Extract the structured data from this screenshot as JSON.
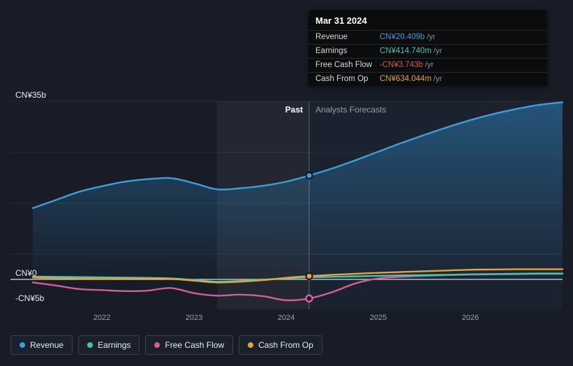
{
  "header": {
    "past_label": "Past",
    "forecast_label": "Analysts Forecasts"
  },
  "tooltip": {
    "date": "Mar 31 2024",
    "rows": [
      {
        "label": "Revenue",
        "value": "CN¥20.409b",
        "suffix": "/yr",
        "color": "#3aa0dc"
      },
      {
        "label": "Earnings",
        "value": "CN¥414.740m",
        "suffix": "/yr",
        "color": "#45c4ae"
      },
      {
        "label": "Free Cash Flow",
        "value": "-CN¥3.743b",
        "suffix": "/yr",
        "color": "#e0524e"
      },
      {
        "label": "Cash From Op",
        "value": "CN¥634.044m",
        "suffix": "/yr",
        "color": "#e5a43b"
      }
    ]
  },
  "legend": {
    "items": [
      {
        "label": "Revenue",
        "color": "#3aa0dc"
      },
      {
        "label": "Earnings",
        "color": "#45c4ae"
      },
      {
        "label": "Free Cash Flow",
        "color": "#d45d9a"
      },
      {
        "label": "Cash From Op",
        "color": "#e5a43b"
      }
    ]
  },
  "colors": {
    "background": "#171c26",
    "zero_line": "#b7bec8",
    "grid": "rgba(255,255,255,0.07)",
    "divider": "rgba(255,255,255,0.3)",
    "forecast_bg": "rgba(110,150,210,0.05)",
    "hover_band": "rgba(255,255,255,0.05)"
  },
  "chart_data": {
    "type": "line",
    "title": "Revenue, earnings and cash flow history with analyst forecasts (CN¥ billions)",
    "ylim": [
      -9.5,
      35
    ],
    "grid": true,
    "legend_position": "bottom-left",
    "y_ticks": [
      {
        "label": "CN¥35b",
        "value": 35
      },
      {
        "label": "CN¥0",
        "value": 0
      },
      {
        "label": "-CN¥5b",
        "value": -5
      }
    ],
    "y_gridlines": [
      35,
      25,
      15,
      5
    ],
    "x_ticks": [
      {
        "label": "2022",
        "value": 2022
      },
      {
        "label": "2023",
        "value": 2023
      },
      {
        "label": "2024",
        "value": 2024
      },
      {
        "label": "2025",
        "value": 2025
      },
      {
        "label": "2026",
        "value": 2026
      }
    ],
    "divider_x": 2024.25,
    "hover_band": [
      2023.25,
      2024.25
    ],
    "marker_x": 2024.25,
    "past_range": [
      2021.25,
      2024.25
    ],
    "forecast_range": [
      2024.25,
      2027
    ],
    "x": [
      2021.25,
      2021.5,
      2021.75,
      2022,
      2022.25,
      2022.5,
      2022.75,
      2023,
      2023.25,
      2023.5,
      2023.75,
      2024,
      2024.25,
      2024.5,
      2024.75,
      2025,
      2025.25,
      2025.5,
      2025.75,
      2026,
      2026.25,
      2026.5,
      2026.75,
      2027
    ],
    "series": [
      {
        "name": "Revenue",
        "color": "#3aa0dc",
        "area": true,
        "marker": "solid",
        "values": [
          14.0,
          15.6,
          17.2,
          18.3,
          19.2,
          19.7,
          19.9,
          18.9,
          17.7,
          17.9,
          18.4,
          19.2,
          20.409,
          21.8,
          23.4,
          25.1,
          26.8,
          28.4,
          29.9,
          31.3,
          32.5,
          33.5,
          34.3,
          34.8
        ]
      },
      {
        "name": "Earnings",
        "color": "#45c4ae",
        "area": false,
        "marker": "none",
        "values": [
          0.55,
          0.5,
          0.45,
          0.4,
          0.35,
          0.3,
          0.2,
          -0.1,
          -0.45,
          -0.3,
          -0.05,
          0.2,
          0.415,
          0.5,
          0.6,
          0.7,
          0.8,
          0.85,
          0.9,
          1.0,
          1.05,
          1.1,
          1.15,
          1.15
        ]
      },
      {
        "name": "Free Cash Flow",
        "color": "#d45d9a",
        "area": false,
        "marker": "ring",
        "values": [
          -0.6,
          -1.2,
          -1.9,
          -2.1,
          -2.3,
          -2.2,
          -1.7,
          -2.7,
          -3.2,
          -3.0,
          -3.3,
          -4.1,
          -3.743,
          -2.5,
          -0.8,
          0.2,
          0.5,
          0.7,
          0.85,
          0.95,
          1.0,
          1.05,
          1.1,
          1.1
        ]
      },
      {
        "name": "Cash From Op",
        "color": "#e5a43b",
        "area": false,
        "marker": "solid",
        "values": [
          0.35,
          0.25,
          0.15,
          0.1,
          0.15,
          0.2,
          0.1,
          -0.25,
          -0.6,
          -0.45,
          -0.15,
          0.3,
          0.634,
          0.9,
          1.1,
          1.3,
          1.45,
          1.6,
          1.75,
          1.9,
          1.95,
          2.0,
          2.0,
          2.0
        ]
      }
    ]
  }
}
